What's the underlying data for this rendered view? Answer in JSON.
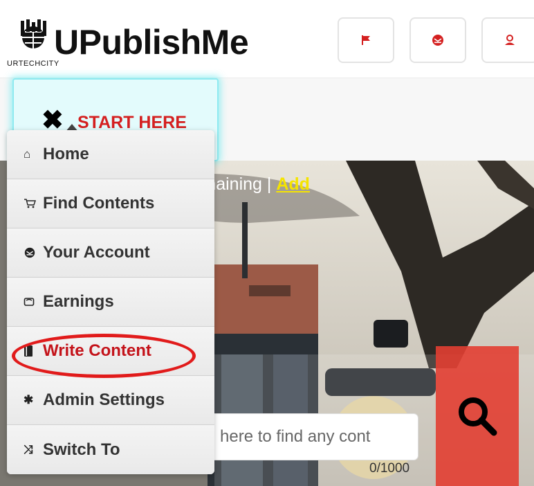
{
  "header": {
    "logo_text": "UPublishMe",
    "logo_sub": "URTECHCITY",
    "buttons": [
      {
        "icon": "flag-icon"
      },
      {
        "icon": "envelope-icon"
      },
      {
        "icon": "user-icon"
      }
    ]
  },
  "start_menu": {
    "label": "START HERE",
    "items": [
      {
        "label": "Home",
        "icon": "home-icon"
      },
      {
        "label": "Find Contents",
        "icon": "cart-icon"
      },
      {
        "label": "Your Account",
        "icon": "envelope-icon"
      },
      {
        "label": "Earnings",
        "icon": "money-icon"
      },
      {
        "label": "Write Content",
        "icon": "book-icon"
      },
      {
        "label": "Admin Settings",
        "icon": "gear-icon"
      },
      {
        "label": "Switch To",
        "icon": "shuffle-icon"
      }
    ]
  },
  "info_bar": {
    "remaining_text": "s Remaining | ",
    "add_label": "Add"
  },
  "search": {
    "value": "here to find any cont",
    "counter": "0/1000"
  },
  "colors": {
    "accent_red": "#d42020",
    "search_button": "#e23e32",
    "highlight_yellow": "#f5e400"
  }
}
